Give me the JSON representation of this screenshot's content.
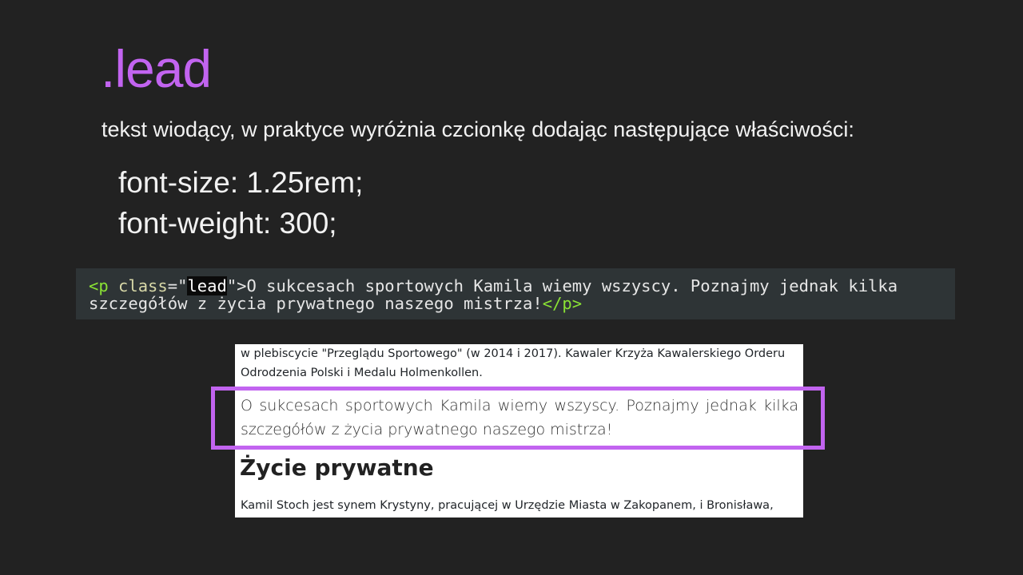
{
  "slide": {
    "title": ".lead",
    "subtitle": "tekst wiodący, w praktyce wyróżnia czcionkę dodając następujące właściwości:",
    "properties": [
      "font-size: 1.25rem;",
      "font-weight: 300;"
    ]
  },
  "code": {
    "open_tag_start": "<p ",
    "attr_name": "class",
    "equals_quote": "=\"",
    "attr_value": "lead",
    "close_quote_tag": "\">",
    "text_line1": "O sukcesach sportowych Kamila wiemy wszyscy. Poznajmy jednak kilka",
    "text_line2": "szczegółów z życia prywatnego naszego mistrza!",
    "close_tag": "</p>"
  },
  "preview": {
    "intro_line1": "w plebiscycie \"Przeglądu Sportowego\" (w 2014 i 2017). Kawaler Krzyża Kawalerskiego Orderu",
    "intro_line2": "Odrodzenia Polski i Medalu Holmenkollen.",
    "lead": "O sukcesach sportowych Kamila wiemy wszyscy. Poznajmy jednak kilka szczegółów z życia prywatnego naszego mistrza!",
    "heading": "Życie prywatne",
    "body": "Kamil Stoch jest synem Krystyny, pracującej w Urzędzie Miasta w Zakopanem, i Bronisława,"
  },
  "colors": {
    "accent": "#c264f0",
    "background": "#222222",
    "code_background": "#2e3436",
    "code_tag": "#8ae234"
  }
}
